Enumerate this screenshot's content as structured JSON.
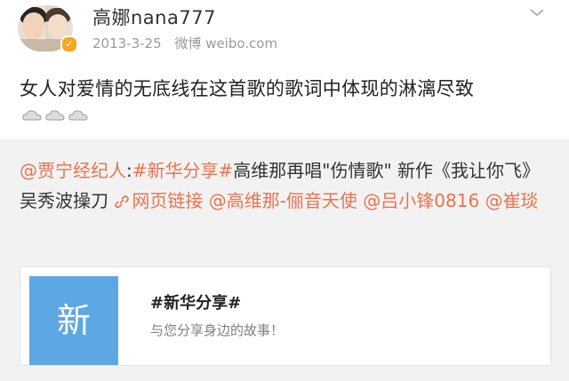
{
  "post": {
    "username": "高娜nana777",
    "date": "2013-3-25",
    "source": "微博 weibo.com",
    "text": "女人对爱情的无底线在这首歌的歌词中体现的淋漓尽致",
    "emoji": [
      "cloud-emoji",
      "cloud-emoji",
      "cloud-emoji"
    ],
    "verified_icon": "verified-icon",
    "menu_icon": "chevron-down-icon"
  },
  "repost": {
    "author": "@贾宁经纪人",
    "colon": ":",
    "topic": "#新华分享#",
    "text1": "高维那再唱\"伤情歌\" 新作《我让你飞》吴秀波操刀 ",
    "link_label": "网页链接",
    "mention1": "@高维那-俪音天使",
    "mention2": "@吕小锋0816",
    "mention3": "@崔琰",
    "card": {
      "thumb_text": "新",
      "title": "#新华分享#",
      "description": "与您分享身边的故事！"
    }
  },
  "colors": {
    "link": "#eb7350",
    "thumb": "#5da8e3",
    "badge": "#f5a623"
  }
}
